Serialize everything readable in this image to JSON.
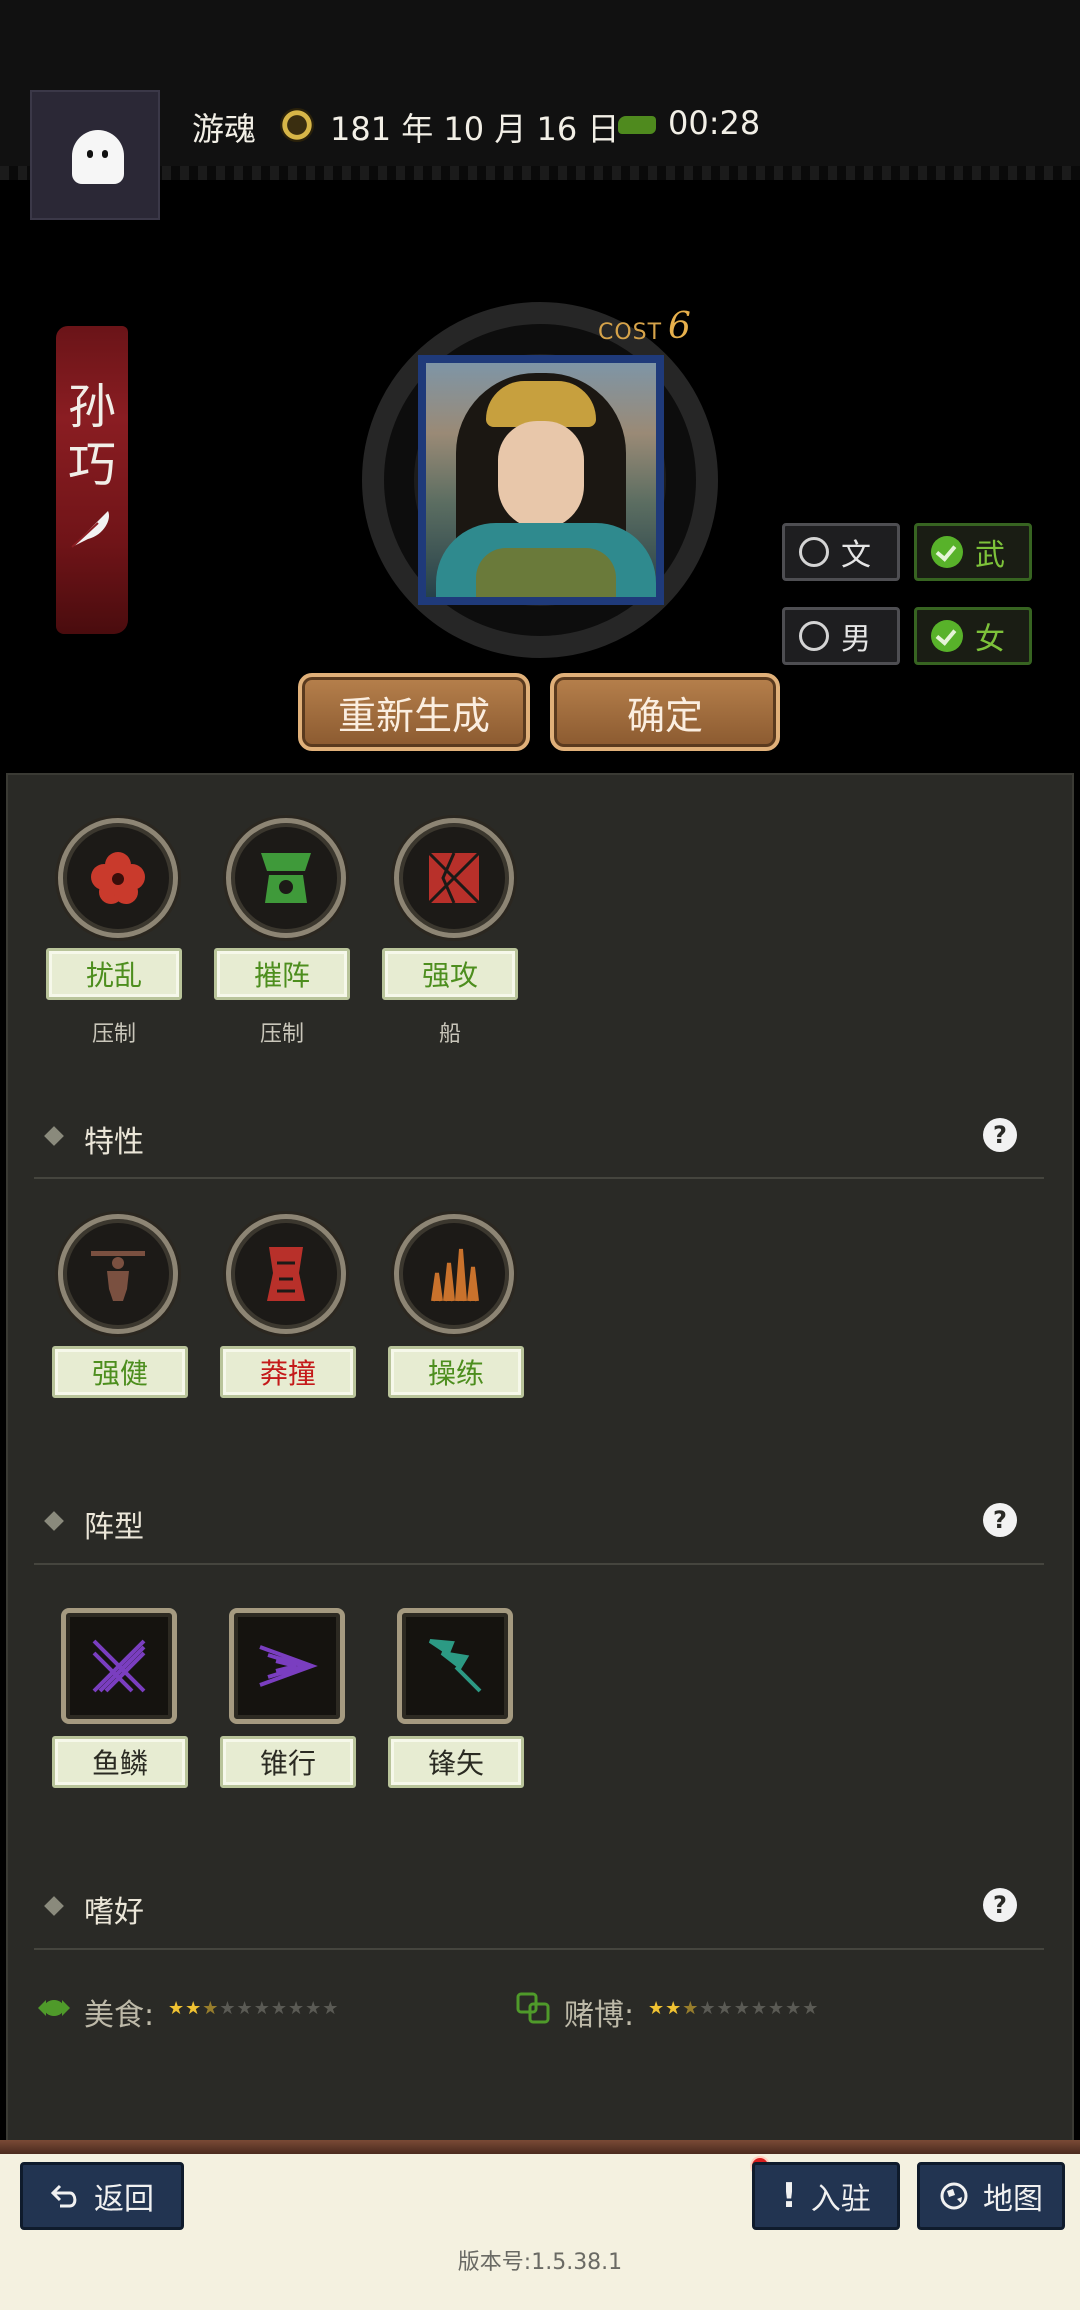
{
  "header": {
    "player_name": "游魂",
    "date": "181 年 10 月 16 日",
    "time": "00:28"
  },
  "character": {
    "name_line1": "孙",
    "name_line2": "巧",
    "cost_label": "COST",
    "cost_value": "6"
  },
  "toggles": {
    "wen": {
      "label": "文",
      "checked": false
    },
    "wu": {
      "label": "武",
      "checked": true
    },
    "nan": {
      "label": "男",
      "checked": false
    },
    "nv": {
      "label": "女",
      "checked": true
    }
  },
  "actions": {
    "regenerate": "重新生成",
    "confirm": "确定"
  },
  "skills": [
    {
      "label": "扰乱",
      "sub": "压制",
      "icon": "flower-icon",
      "color": "#c93a2c"
    },
    {
      "label": "摧阵",
      "sub": "压制",
      "icon": "shatter-icon",
      "color": "#3f9a3a"
    },
    {
      "label": "强攻",
      "sub": "船",
      "icon": "cracked-square-icon",
      "color": "#b8302a"
    }
  ],
  "traits": {
    "title": "特性",
    "items": [
      {
        "label": "强健",
        "icon": "strongman-icon",
        "label_color": "green"
      },
      {
        "label": "莽撞",
        "icon": "charge-icon",
        "label_color": "red"
      },
      {
        "label": "操练",
        "icon": "spears-icon",
        "label_color": "green"
      }
    ]
  },
  "formations": {
    "title": "阵型",
    "items": [
      {
        "label": "鱼鳞",
        "icon": "fish-scale-icon"
      },
      {
        "label": "锥行",
        "icon": "wedge-icon"
      },
      {
        "label": "锋矢",
        "icon": "arrow-icon"
      }
    ]
  },
  "hobbies": {
    "title": "嗜好",
    "items": [
      {
        "label": "美食:",
        "icon": "candy-icon",
        "stars": 2.5,
        "max_stars": 10
      },
      {
        "label": "赌博:",
        "icon": "dice-icon",
        "stars": 2.5,
        "max_stars": 10
      }
    ]
  },
  "footer": {
    "back": "返回",
    "join": "入驻",
    "map": "地图",
    "version": "版本号:1.5.38.1"
  }
}
